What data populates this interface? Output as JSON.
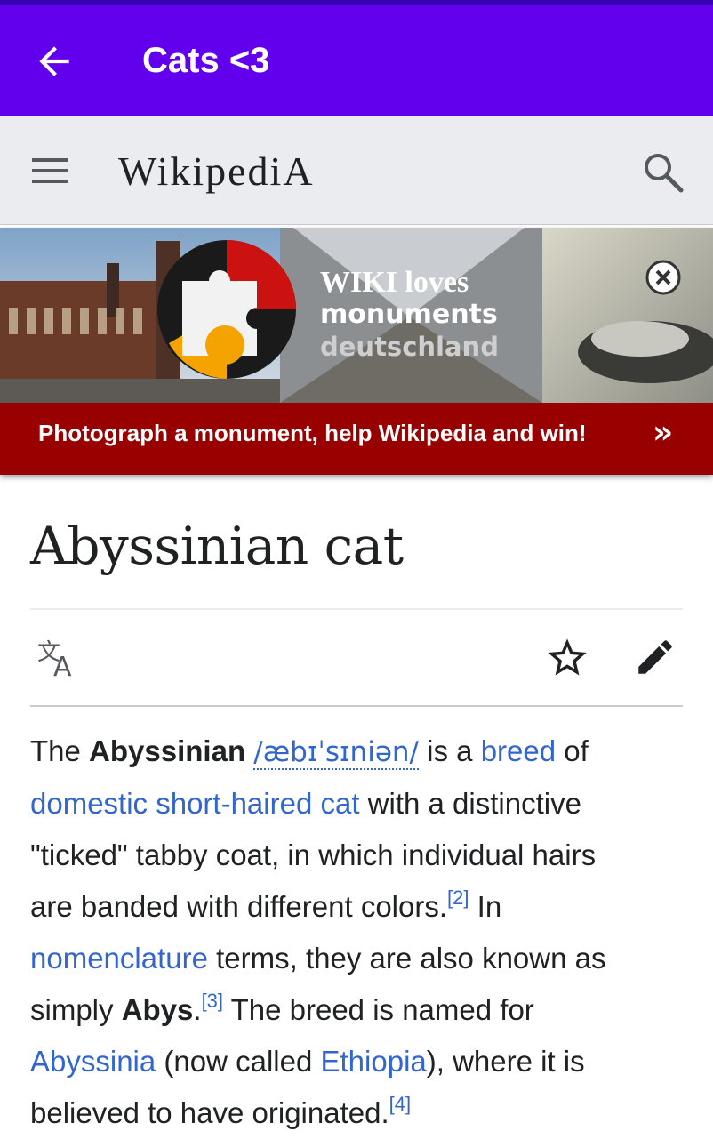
{
  "appbar": {
    "title": "Cats <3",
    "background": "#6200ee"
  },
  "wiki_header": {
    "wordmark": "WikipediA"
  },
  "banner": {
    "logo_line1": "WIKI loves",
    "logo_line2": "monuments",
    "logo_line3": "deutschland",
    "cta": "Photograph a monument, help Wikipedia and win!",
    "cta_arrow": "»",
    "cta_color": "#990000"
  },
  "article": {
    "title": "Abyssinian cat",
    "p1": {
      "t1": "The ",
      "b1": "Abyssinian",
      "t2": " ",
      "ipa": "/æbɪˈsɪniən/",
      "t3": " is a ",
      "l_breed": "breed",
      "t4": " of",
      "l_domestic": "domestic short-haired cat",
      "t5": " with a distinctive",
      "t6": "\"ticked\" tabby coat, in which individual hairs",
      "t7": "are banded with different colors.",
      "ref2": "[2]",
      "t8": " In",
      "l_nomenclature": "nomenclature",
      "t9": " terms, they are also known as",
      "t10": "simply ",
      "b2": "Abys",
      "t11": ".",
      "ref3": "[3]",
      "t12": " The breed is named for",
      "l_abyssinia": "Abyssinia",
      "t13": " (now called ",
      "l_ethiopia": "Ethiopia",
      "t14": "), where it is",
      "t15": "believed to have originated.",
      "ref4": "[4]"
    }
  },
  "colors": {
    "link": "#3366cc",
    "text": "#202122"
  },
  "icons": [
    "arrow-back-icon",
    "menu-icon",
    "search-icon",
    "close-circle-icon",
    "translate-icon",
    "star-outline-icon",
    "pencil-icon"
  ]
}
